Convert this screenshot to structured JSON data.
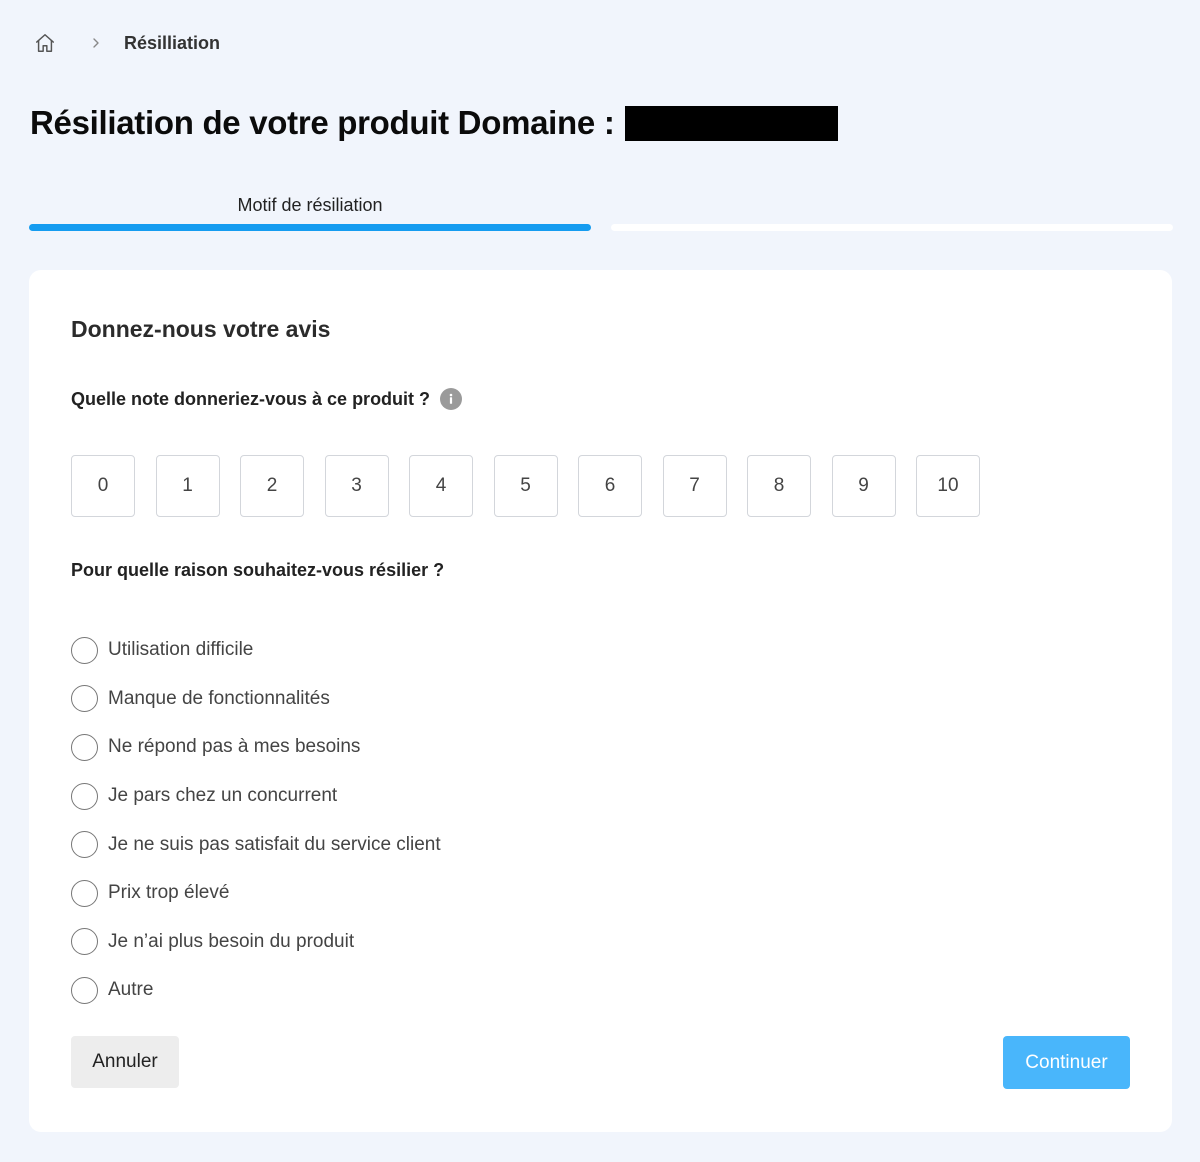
{
  "breadcrumb": {
    "home_icon": "home-icon",
    "separator_icon": "chevron-right-icon",
    "current": "Résilliation"
  },
  "page": {
    "title": "Résiliation de votre produit Domaine :"
  },
  "steps": [
    {
      "label": "Motif de résiliation",
      "active": true
    },
    {
      "label": "",
      "active": false
    }
  ],
  "card": {
    "title": "Donnez-nous votre avis",
    "rating_question": "Quelle note donneriez-vous à ce produit ?",
    "info_icon": "info-icon",
    "scores": [
      "0",
      "1",
      "2",
      "3",
      "4",
      "5",
      "6",
      "7",
      "8",
      "9",
      "10"
    ],
    "reason_question": "Pour quelle raison souhaitez-vous résilier ?",
    "reasons": [
      "Utilisation difficile",
      "Manque de fonctionnalités",
      "Ne répond pas à mes besoins",
      "Je pars chez un concurrent",
      "Je ne suis pas satisfait du service client",
      "Prix trop élevé",
      "Je n’ai plus besoin du produit",
      "Autre"
    ]
  },
  "actions": {
    "cancel_label": "Annuler",
    "continue_label": "Continuer"
  },
  "colors": {
    "accent": "#159cf0",
    "continue_button": "#49b6fb",
    "background": "#f1f5fc"
  }
}
